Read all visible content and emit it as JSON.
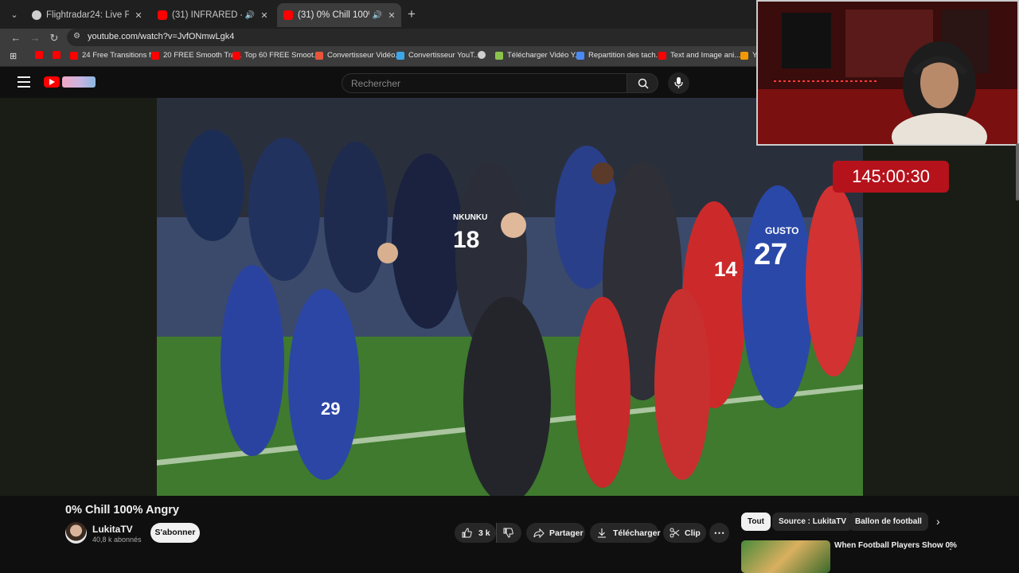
{
  "browser": {
    "tabs": [
      {
        "title": "Flightradar24: Live Flight Tracker",
        "favicon_color": "#cfcfcf",
        "active": false,
        "audio": false
      },
      {
        "title": "(31) INFRARED - YouTube",
        "favicon_color": "#ff0000",
        "active": false,
        "audio": true
      },
      {
        "title": "(31) 0% Chill 100% Angry - YouTube",
        "favicon_color": "#ff0000",
        "active": true,
        "audio": true
      }
    ],
    "new_tab": "+",
    "url": "youtube.com/watch?v=JvfONmwLgk4",
    "bookmarks": [
      {
        "label": "",
        "color": "#ff0000"
      },
      {
        "label": "",
        "color": "#ff0000"
      },
      {
        "label": "24 Free Transitions f...",
        "color": "#ff0000"
      },
      {
        "label": "20 FREE Smooth Tra...",
        "color": "#ff0000"
      },
      {
        "label": "Top 60 FREE Smoot...",
        "color": "#ff0000"
      },
      {
        "label": "Convertisseur Vidéo...",
        "color": "#e8553a"
      },
      {
        "label": "Convertisseur YouT...",
        "color": "#3aa8e8"
      },
      {
        "label": "",
        "color": "#cfcfcf"
      },
      {
        "label": "Télécharger Vidéo Y...",
        "color": "#8bc34a"
      },
      {
        "label": "Repartition des tach...",
        "color": "#4a8af4"
      },
      {
        "label": "Text and Image ani...",
        "color": "#ff0000"
      },
      {
        "label": "Y...",
        "color": "#f29900"
      }
    ]
  },
  "youtube": {
    "search_placeholder": "Rechercher",
    "timer": "145:00:30",
    "video": {
      "title": "0% Chill 100% Angry",
      "channel": "LukitaTV",
      "subscribers": "40,8 k abonnés",
      "subscribe_label": "S'abonner",
      "likes": "3 k",
      "share_label": "Partager",
      "download_label": "Télécharger",
      "clip_label": "Clip",
      "jersey_names": [
        "NKUNKU",
        "GUSTO"
      ],
      "jersey_numbers": [
        "18",
        "27",
        "29",
        "14"
      ]
    },
    "chips": [
      "Tout",
      "Source : LukitaTV",
      "Ballon de football"
    ],
    "recommendation": {
      "title": "When Football Players Show 0%"
    }
  }
}
